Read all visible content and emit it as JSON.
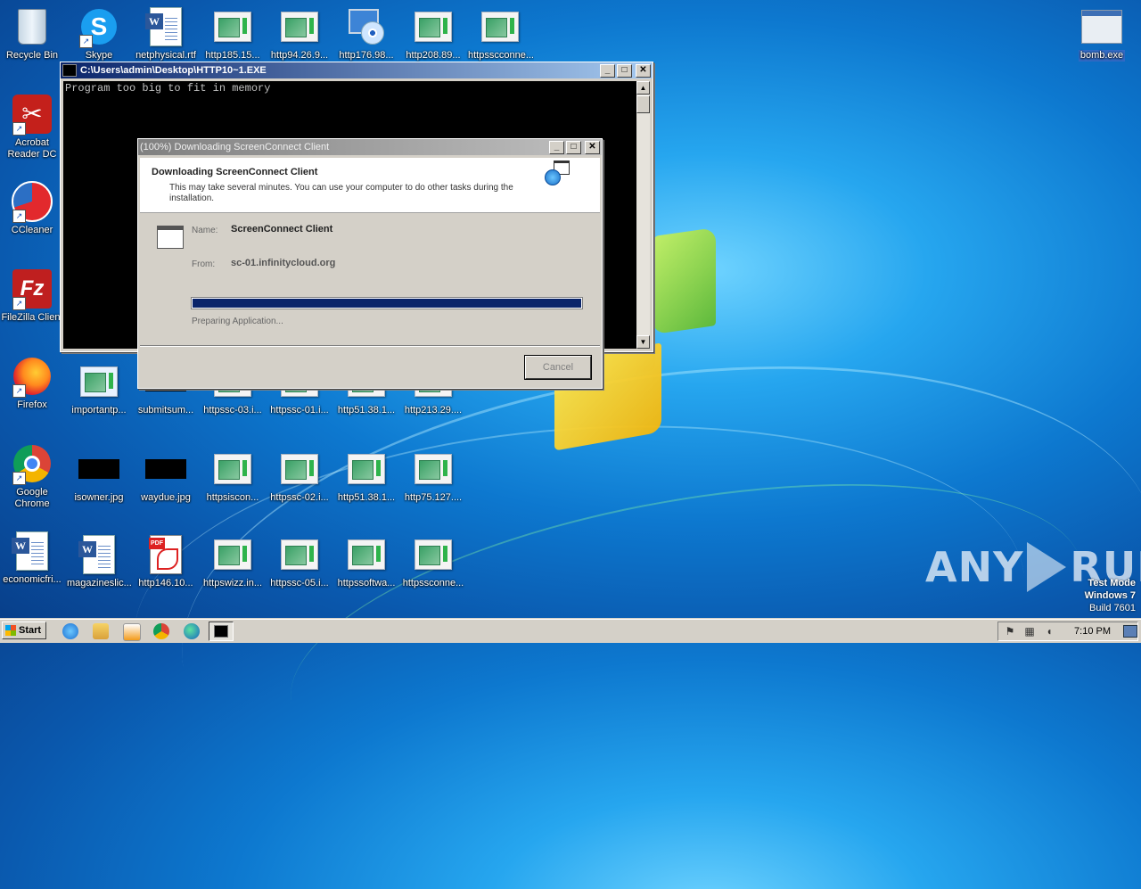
{
  "desktop": {
    "icons_col1": [
      {
        "label": "Recycle Bin",
        "icon": "recycle-bin-icon"
      },
      {
        "label": "Acrobat Reader DC",
        "icon": "acrobat-icon"
      },
      {
        "label": "CCleaner",
        "icon": "ccleaner-icon"
      },
      {
        "label": "FileZilla Client",
        "icon": "filezilla-icon"
      },
      {
        "label": "Firefox",
        "icon": "firefox-icon"
      },
      {
        "label": "Google Chrome",
        "icon": "chrome-icon"
      },
      {
        "label": "economicfri...",
        "icon": "word-doc-icon"
      }
    ],
    "top_row": [
      {
        "label": "Skype",
        "icon": "skype-icon"
      },
      {
        "label": "netphysical.rtf",
        "icon": "word-doc-icon"
      },
      {
        "label": "http185.15...",
        "icon": "html-file-icon"
      },
      {
        "label": "http94.26.9...",
        "icon": "html-file-icon"
      },
      {
        "label": "http176.98...",
        "icon": "cd-monitor-icon"
      },
      {
        "label": "http208.89...",
        "icon": "html-file-icon"
      },
      {
        "label": "httpsscconne...",
        "icon": "html-file-icon"
      }
    ],
    "row_457": [
      {
        "label": "importantp...",
        "icon": "file-icon"
      },
      {
        "label": "submitsum...",
        "icon": "image-icon"
      },
      {
        "label": "httpssc-03.i...",
        "icon": "html-file-icon"
      },
      {
        "label": "httpssc-01.i...",
        "icon": "html-file-icon"
      },
      {
        "label": "http51.38.1...",
        "icon": "html-file-icon"
      },
      {
        "label": "http213.29....",
        "icon": "html-file-icon"
      }
    ],
    "row_555": [
      {
        "label": "isowner.jpg",
        "icon": "image-icon"
      },
      {
        "label": "waydue.jpg",
        "icon": "image-icon"
      },
      {
        "label": "httpsiscon...",
        "icon": "html-file-icon"
      },
      {
        "label": "httpssc-02.i...",
        "icon": "html-file-icon"
      },
      {
        "label": "http51.38.1...",
        "icon": "html-file-icon"
      },
      {
        "label": "http75.127....",
        "icon": "html-file-icon"
      }
    ],
    "row_653": [
      {
        "label": "magazineslic...",
        "icon": "word-doc-icon"
      },
      {
        "label": "http146.10...",
        "icon": "pdf-file-icon"
      },
      {
        "label": "httpswizz.in...",
        "icon": "html-file-icon"
      },
      {
        "label": "httpssc-05.i...",
        "icon": "html-file-icon"
      },
      {
        "label": "httpssoftwa...",
        "icon": "html-file-icon"
      },
      {
        "label": "httpssconne...",
        "icon": "html-file-icon"
      }
    ],
    "right_icon": {
      "label": "bomb.exe",
      "icon": "exe-icon"
    }
  },
  "console": {
    "title": "C:\\Users\\admin\\Desktop\\HTTP10~1.EXE",
    "output": "Program too big to fit in memory"
  },
  "dialog": {
    "title": "(100%) Downloading ScreenConnect Client",
    "heading": "Downloading ScreenConnect Client",
    "subtext": "This may take several minutes. You can use your computer to do other tasks during the installation.",
    "name_label": "Name:",
    "name_value": "ScreenConnect Client",
    "from_label": "From:",
    "from_value": "sc-01.infinitycloud.org",
    "progress_percent": 100,
    "status": "Preparing Application...",
    "cancel_label": "Cancel"
  },
  "watermark": {
    "left": "ANY",
    "right": "RUN"
  },
  "test_mode": {
    "line1": "Test Mode",
    "line2": "Windows 7",
    "line3": "Build 7601"
  },
  "taskbar": {
    "start_label": "Start",
    "clock": "7:10 PM",
    "quick_launch": [
      "ie-icon",
      "explorer-icon",
      "media-player-icon",
      "chrome-icon",
      "edge-icon"
    ]
  },
  "colors": {
    "title_active": "#0a246a",
    "progress": "#0a246a",
    "face": "#d4d0c8"
  }
}
